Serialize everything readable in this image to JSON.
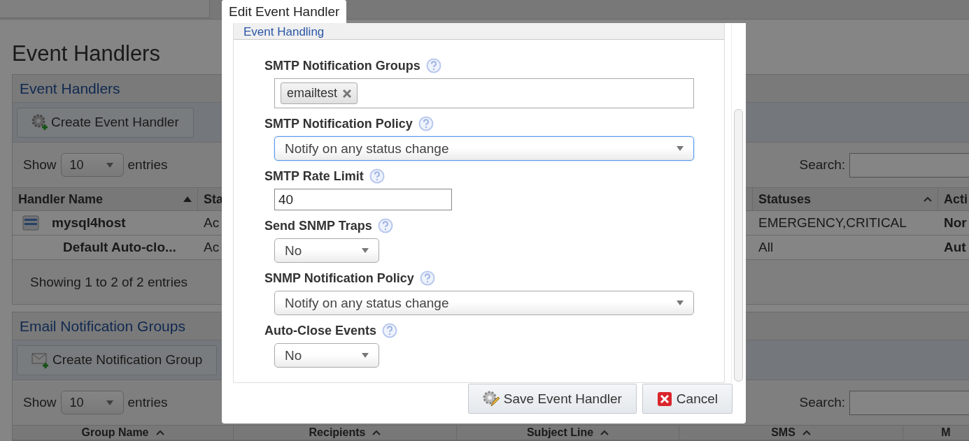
{
  "page": {
    "title": "Event Handlers"
  },
  "handlers_panel": {
    "title": "Event Handlers",
    "create_button": "Create Event Handler",
    "show_label": "Show",
    "page_size": "10",
    "entries_label": "entries",
    "search_label": "Search:",
    "columns": [
      {
        "label": "Handler Name",
        "sorted": true
      },
      {
        "label": "Sta"
      },
      {
        "label": "Statuses",
        "sorted": false
      },
      {
        "label": "Acti"
      }
    ],
    "rows": [
      {
        "kind": "host",
        "name": "mysql4host",
        "column_2": "Ac",
        "statuses": "EMERGENCY,CRITICAL",
        "column_4": "Nor"
      },
      {
        "kind": "default",
        "name": "Default Auto-clo...",
        "column_2": "Ac",
        "statuses": "All",
        "column_4": "Aut"
      }
    ],
    "info": "Showing 1 to 2 of 2 entries"
  },
  "groups_panel": {
    "title": "Email Notification Groups",
    "create_button": "Create Notification Group",
    "show_label": "Show",
    "page_size": "10",
    "entries_label": "entries",
    "search_label": "Search:",
    "columns": [
      {
        "label": "Group Name",
        "sorted": false
      },
      {
        "label": "Recipients",
        "sorted": false
      },
      {
        "label": "Subject Line",
        "sorted": false
      },
      {
        "label": "SMS",
        "sorted": false
      },
      {
        "label": "M"
      }
    ]
  },
  "dialog": {
    "title": "Edit Event Handler",
    "section_title": "Event Handling",
    "fields": [
      {
        "kind": "tags",
        "label": "SMTP Notification Groups",
        "tags": [
          "emailtest"
        ]
      },
      {
        "kind": "dropdown",
        "label": "SMTP Notification Policy",
        "value": "Notify on any status change",
        "focused": true
      },
      {
        "kind": "text",
        "label": "SMTP Rate Limit",
        "value": "40"
      },
      {
        "kind": "yes_no",
        "label": "Send SNMP Traps",
        "value": "No",
        "focused": false
      },
      {
        "kind": "dropdown",
        "label": "SNMP Notification Policy",
        "value": "Notify on any status change",
        "focused": false
      },
      {
        "kind": "yes_no",
        "label": "Auto-Close Events",
        "value": "No",
        "focused": false
      }
    ],
    "buttons": [
      {
        "kind": "save",
        "label": "Save Event Handler"
      },
      {
        "kind": "cancel",
        "label": "Cancel"
      }
    ]
  }
}
